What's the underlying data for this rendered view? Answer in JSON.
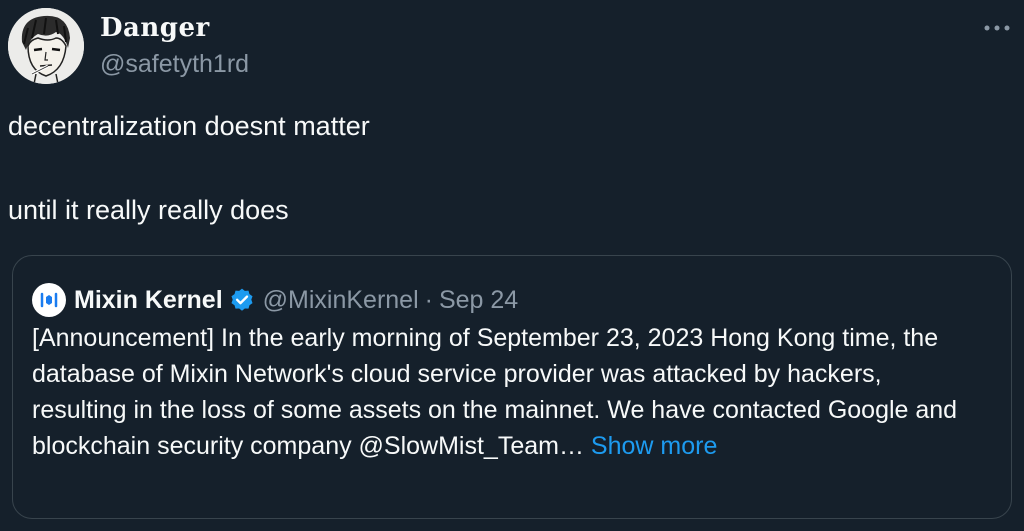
{
  "author": {
    "display_name": "Danger",
    "handle": "@safetyth1rd",
    "avatar": "avatar-illustration"
  },
  "more_icon": "more-horizontal-icon",
  "tweet": {
    "line1": "decentralization doesnt matter",
    "line2": "until it really really does"
  },
  "quote": {
    "name": "Mixin Kernel",
    "verified_icon": "verified-badge-icon",
    "handle": "@MixinKernel",
    "separator": "·",
    "date": "Sep 24",
    "text": "[Announcement] In the early morning of September 23, 2023 Hong Kong time, the database of Mixin Network's cloud service provider was attacked by hackers, resulting in the loss of some assets on the mainnet. We have contacted Google and blockchain security company @SlowMist_Team…",
    "show_more": "Show more"
  },
  "colors": {
    "background": "#15202b",
    "text": "#f7f9f9",
    "secondary": "#8b98a5",
    "accent": "#1d9bf0",
    "border": "#38444d"
  }
}
